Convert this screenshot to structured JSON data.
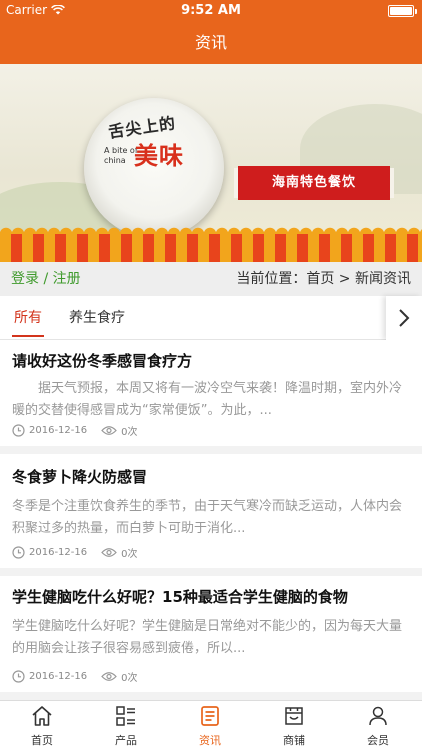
{
  "status_bar": {
    "carrier": "Carrier",
    "time": "9:52 AM"
  },
  "nav": {
    "title": "资讯"
  },
  "banner": {
    "plate_title": "舌尖上的",
    "plate_en": "A bite of china",
    "plate_red": "美味",
    "scroll_text": "海南特色餐饮"
  },
  "account": {
    "login": "登录",
    "separator": " / ",
    "register": "注册"
  },
  "breadcrumb": {
    "prefix": "当前位置：",
    "home": "首页",
    "sep": " > ",
    "current": "新闻资讯"
  },
  "tabs": [
    {
      "label": "所有",
      "active": true
    },
    {
      "label": "养生食疗",
      "active": false
    }
  ],
  "articles": [
    {
      "title": "请收好这份冬季感冒食疗方",
      "summary": "　　据天气预报，本周又将有一波冷空气来袭！降温时期，室内外冷暖的交替使得感冒成为“家常便饭”。为此，...",
      "date": "2016-12-16",
      "views": "0次"
    },
    {
      "title": "冬食萝卜降火防感冒",
      "summary": "冬季是个注重饮食养生的季节，由于天气寒冷而缺乏运动，人体内会积聚过多的热量，而白萝卜可助于消化...",
      "date": "2016-12-16",
      "views": "0次"
    },
    {
      "title": "学生健脑吃什么好呢？15种最适合学生健脑的食物",
      "summary": "学生健脑吃什么好呢？学生健脑是日常绝对不能少的，因为每天大量的用脑会让孩子很容易感到疲倦，所以...",
      "date": "2016-12-16",
      "views": "0次"
    }
  ],
  "tabbar": [
    {
      "label": "首页",
      "icon": "home-icon",
      "active": false
    },
    {
      "label": "产品",
      "icon": "grid-list-icon",
      "active": false
    },
    {
      "label": "资讯",
      "icon": "news-icon",
      "active": true
    },
    {
      "label": "商铺",
      "icon": "store-icon",
      "active": false
    },
    {
      "label": "会员",
      "icon": "user-icon",
      "active": false
    }
  ],
  "colors": {
    "brand": "#e8651c",
    "active_tab": "#d3341c",
    "login": "#3f9a2c"
  }
}
